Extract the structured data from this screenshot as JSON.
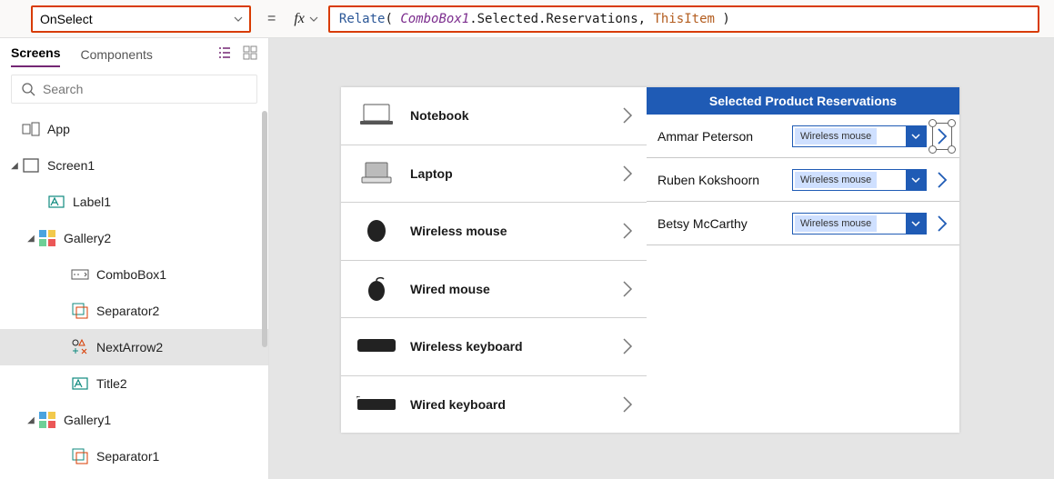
{
  "propertyBar": {
    "property": "OnSelect",
    "formula_fn": "Relate",
    "formula_id": "ComboBox1",
    "formula_dot1": ".Selected.Reservations,",
    "formula_kw": "ThisItem"
  },
  "treeTabs": {
    "screens": "Screens",
    "components": "Components"
  },
  "search": {
    "placeholder": "Search"
  },
  "tree": {
    "app": "App",
    "screen1": "Screen1",
    "label1": "Label1",
    "gallery2": "Gallery2",
    "combobox1": "ComboBox1",
    "separator2": "Separator2",
    "nextarrow2": "NextArrow2",
    "title2": "Title2",
    "gallery1": "Gallery1",
    "separator1": "Separator1"
  },
  "products": [
    {
      "name": "Notebook"
    },
    {
      "name": "Laptop"
    },
    {
      "name": "Wireless mouse"
    },
    {
      "name": "Wired mouse"
    },
    {
      "name": "Wireless keyboard"
    },
    {
      "name": "Wired keyboard"
    }
  ],
  "reservations": {
    "header": "Selected Product Reservations",
    "rows": [
      {
        "name": "Ammar Peterson",
        "combo": "Wireless mouse"
      },
      {
        "name": "Ruben Kokshoorn",
        "combo": "Wireless mouse"
      },
      {
        "name": "Betsy McCarthy",
        "combo": "Wireless mouse"
      }
    ]
  }
}
